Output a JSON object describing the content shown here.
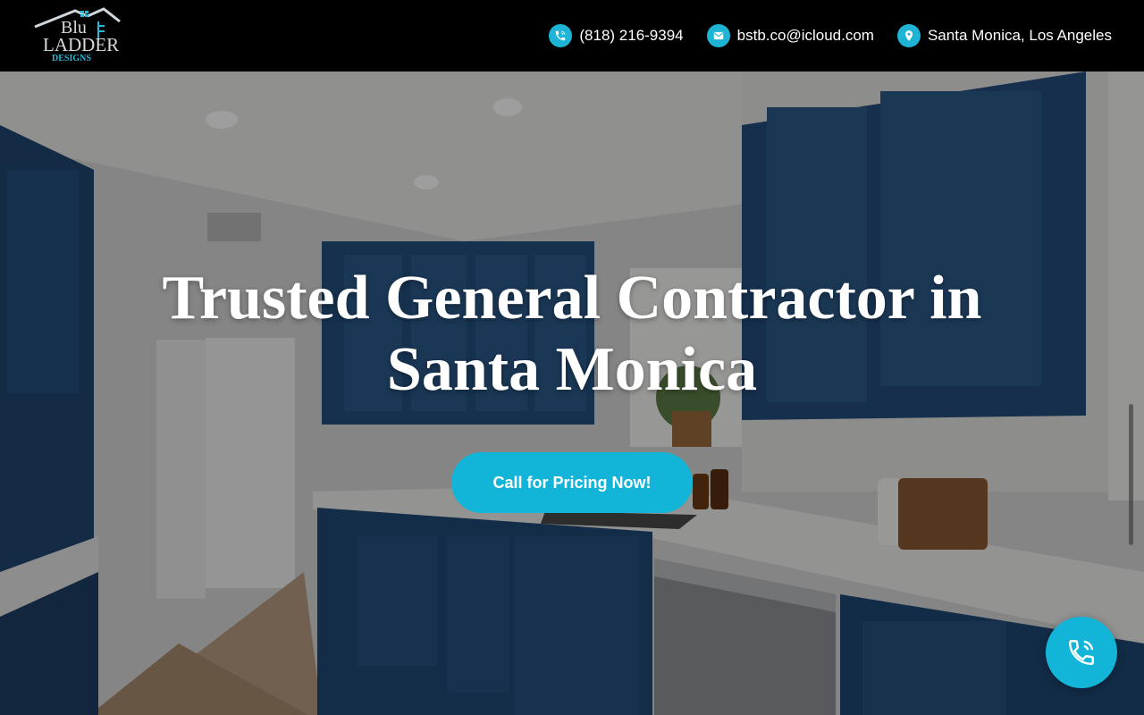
{
  "header": {
    "logo": {
      "line1": "Blu",
      "line2": "LADDER",
      "line3": "DESIGNS"
    },
    "phone": {
      "label": "(818) 216-9394",
      "icon": "phone-icon"
    },
    "email": {
      "label": "bstb.co@icloud.com",
      "icon": "mail-icon"
    },
    "location": {
      "label": "Santa Monica, Los Angeles",
      "icon": "map-pin-icon"
    }
  },
  "hero": {
    "title_line1": "Trusted General Contractor in",
    "title_line2": "Santa Monica",
    "cta_label": "Call for Pricing Now!"
  },
  "floating_button": {
    "icon": "phone-call-icon"
  },
  "colors": {
    "accent": "#12b5d8",
    "header_bg": "#000000",
    "cabinet_blue": "#234b78"
  }
}
